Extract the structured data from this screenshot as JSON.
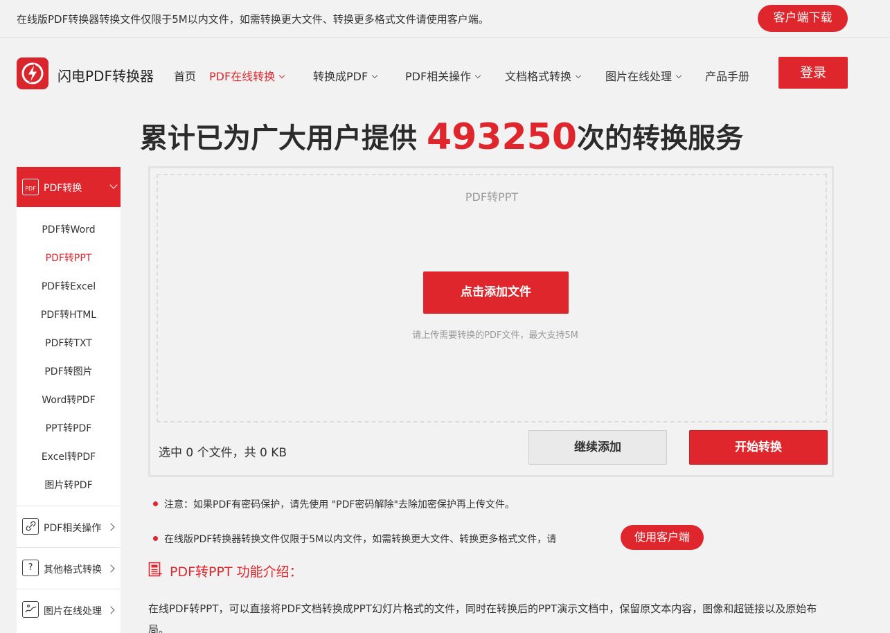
{
  "topbar": {
    "notice": "在线版PDF转换器转换文件仅限于5M以内文件，如需转换更大文件、转换更多格式文件请使用客户端。",
    "download_label": "客户端下载"
  },
  "header": {
    "brand": "闪电PDF转换器",
    "nav": [
      {
        "label": "首页"
      },
      {
        "label": "PDF在线转换"
      },
      {
        "label": "转换成PDF"
      },
      {
        "label": "PDF相关操作"
      },
      {
        "label": "文档格式转换"
      },
      {
        "label": "图片在线处理"
      },
      {
        "label": "产品手册"
      }
    ],
    "login_label": "登录"
  },
  "headline": {
    "prefix": "累计已为广大用户提供 ",
    "count": "493250",
    "suffix": "次的转换服务"
  },
  "sidebar": {
    "head_icon_text": "PDF",
    "head_label": "PDF转换",
    "items": [
      {
        "label": "PDF转Word"
      },
      {
        "label": "PDF转PPT"
      },
      {
        "label": "PDF转Excel"
      },
      {
        "label": "PDF转HTML"
      },
      {
        "label": "PDF转TXT"
      },
      {
        "label": "PDF转图片"
      },
      {
        "label": "Word转PDF"
      },
      {
        "label": "PPT转PDF"
      },
      {
        "label": "Excel转PDF"
      },
      {
        "label": "图片转PDF"
      }
    ],
    "groups": [
      {
        "label": "PDF相关操作",
        "icon": "link-icon"
      },
      {
        "label": "其他格式转换",
        "icon_text": "?"
      },
      {
        "label": "图片在线处理",
        "icon": "image-icon"
      }
    ]
  },
  "upload": {
    "title": "PDF转PPT",
    "add_label": "点击添加文件",
    "hint": "请上传需要转换的PDF文件，最大支持5M",
    "summary": "选中 0 个文件，共 0 KB",
    "continue_label": "继续添加",
    "start_label": "开始转换"
  },
  "notes": [
    "注意：如果PDF有密码保护，请先使用 \"PDF密码解除\"去除加密保护再上传文件。",
    "在线版PDF转换器转换文件仅限于5M以内文件，如需转换更大文件、转换更多格式文件，请"
  ],
  "use_client_label": "使用客户端",
  "intro": {
    "title": "PDF转PPT 功能介绍：",
    "text": "在线PDF转PPT，可以直接将PDF文档转换成PPT幻灯片格式的文件，同时在转换后的PPT演示文档中，保留原文本内容，图像和超链接以及原始布局。"
  },
  "colors": {
    "accent": "#e0262d"
  }
}
